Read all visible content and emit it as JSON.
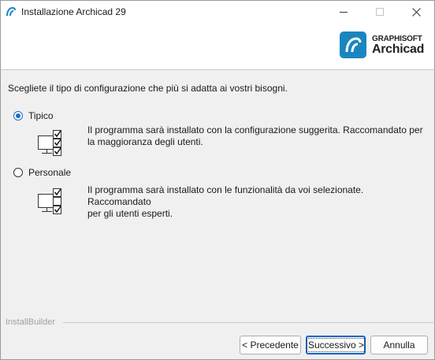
{
  "window": {
    "title": "Installazione Archicad 29"
  },
  "header": {
    "logo_top": "GRAPHISOFT",
    "logo_main": "Archicad"
  },
  "main": {
    "prompt": "Scegliete il tipo di configurazione che più si adatta ai vostri bisogni.",
    "options": [
      {
        "label": "Tipico",
        "selected": true,
        "icon": "all-features-checked-icon",
        "description_line1": "Il programma sarà installato con la configurazione suggerita. Raccomandato per",
        "description_line2": "la maggioranza degli utenti."
      },
      {
        "label": "Personale",
        "selected": false,
        "icon": "some-features-checked-icon",
        "description_line1": "Il programma sarà installato con le funzionalità da voi selezionate. Raccomandato",
        "description_line2": "per gli utenti esperti."
      }
    ]
  },
  "footer": {
    "brand": "InstallBuilder",
    "prev_label": "< Precedente",
    "next_label": "Successivo >",
    "cancel_label": "Annulla"
  },
  "colors": {
    "accent": "#1a6fc0",
    "logo_blue": "#1a86bf",
    "background": "#f0f0f0"
  }
}
